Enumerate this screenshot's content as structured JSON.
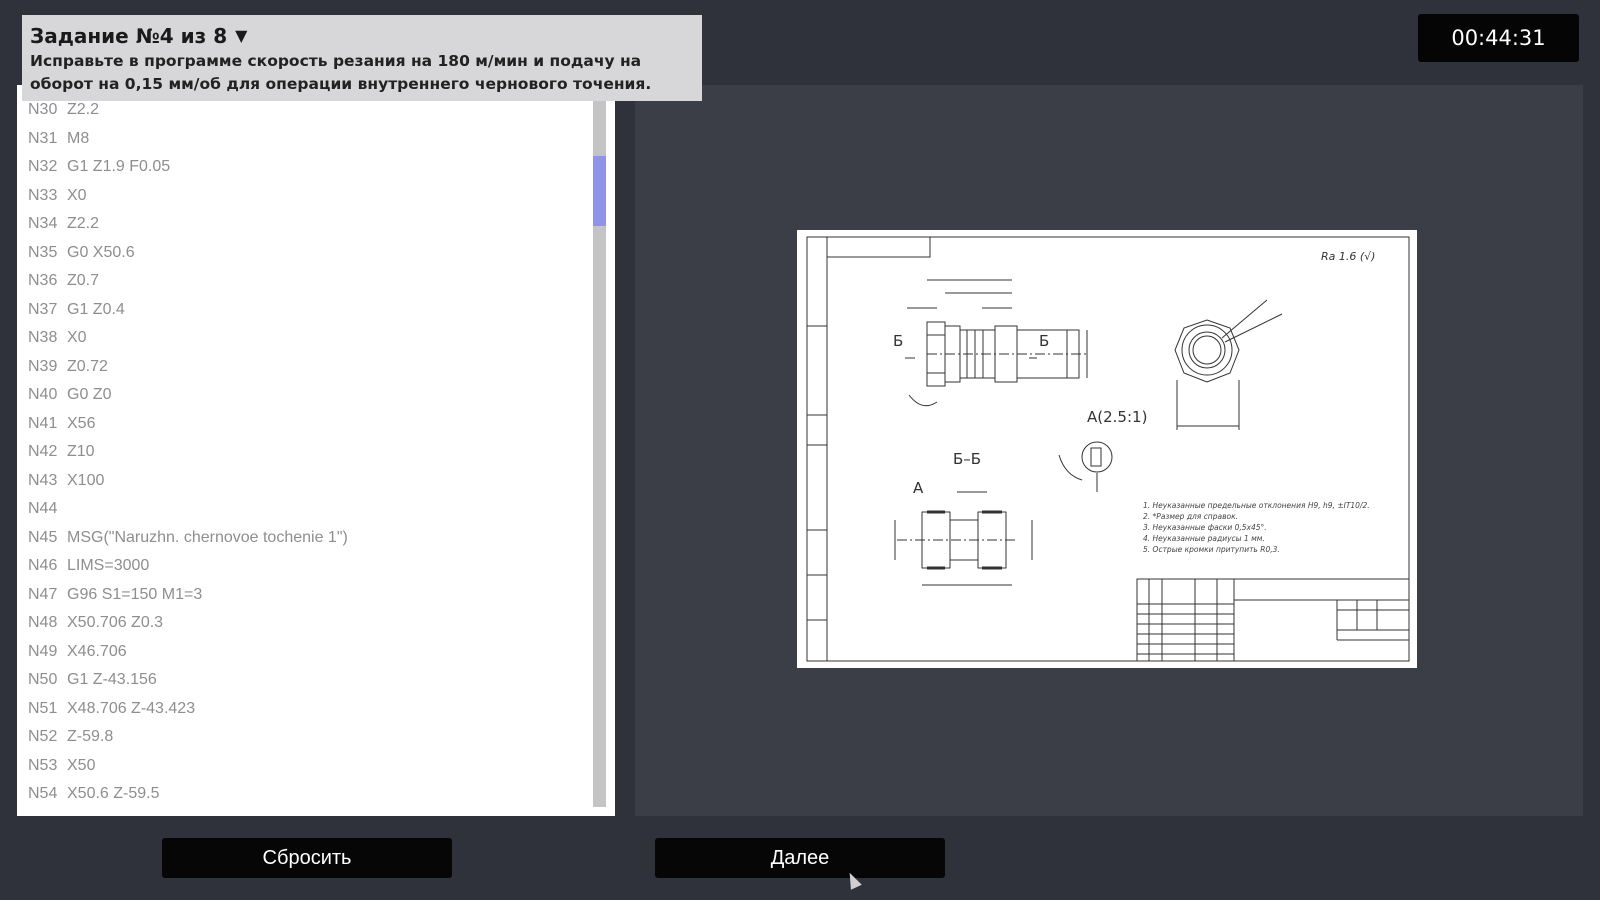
{
  "task": {
    "title": "Задание №4 из 8",
    "dropdown_icon": "triangle-down-icon",
    "description": "Исправьте в программе скорость резания на 180 м/мин и подачу на оборот на 0,15 мм/об для операции внутреннего чернового точения."
  },
  "timer": "00:44:31",
  "code": {
    "lines": [
      {
        "n": "N30",
        "t": "Z2.2"
      },
      {
        "n": "N31",
        "t": "M8"
      },
      {
        "n": "N32",
        "t": "G1 Z1.9 F0.05"
      },
      {
        "n": "N33",
        "t": "X0"
      },
      {
        "n": "N34",
        "t": "Z2.2"
      },
      {
        "n": "N35",
        "t": "G0 X50.6"
      },
      {
        "n": "N36",
        "t": "Z0.7"
      },
      {
        "n": "N37",
        "t": "G1 Z0.4"
      },
      {
        "n": "N38",
        "t": "X0"
      },
      {
        "n": "N39",
        "t": "Z0.72"
      },
      {
        "n": "N40",
        "t": "G0 Z0"
      },
      {
        "n": "N41",
        "t": "X56"
      },
      {
        "n": "N42",
        "t": "Z10"
      },
      {
        "n": "N43",
        "t": "X100"
      },
      {
        "n": "N44",
        "t": ""
      },
      {
        "n": "N45",
        "t": "MSG(\"Naruzhn. chernovoe tochenie 1\")"
      },
      {
        "n": "N46",
        "t": "LIMS=3000"
      },
      {
        "n": "N47",
        "t": "G96 S1=150 M1=3"
      },
      {
        "n": "N48",
        "t": "X50.706 Z0.3"
      },
      {
        "n": "N49",
        "t": "X46.706"
      },
      {
        "n": "N50",
        "t": "G1 Z-43.156"
      },
      {
        "n": "N51",
        "t": "X48.706 Z-43.423"
      },
      {
        "n": "N52",
        "t": "Z-59.8"
      },
      {
        "n": "N53",
        "t": "X50"
      },
      {
        "n": "N54",
        "t": "X50.6 Z-59.5"
      }
    ]
  },
  "drawing": {
    "roughness": "Ra 1.6 (√)",
    "section_b": "Б",
    "section_bb": "Б–Б",
    "detail_a": "А",
    "detail_a_scale": "А(2.5:1)",
    "notes": [
      "1. Неуказанные предельные отклонения H9, h9, ±IT10/2.",
      "2. *Размер для справок.",
      "3. Неуказанные фаски 0,5х45°.",
      "4. Неуказанные радиусы 1 мм.",
      "5. Острые кромки притупить R0,3."
    ]
  },
  "buttons": {
    "reset": "Сбросить",
    "next": "Далее"
  }
}
